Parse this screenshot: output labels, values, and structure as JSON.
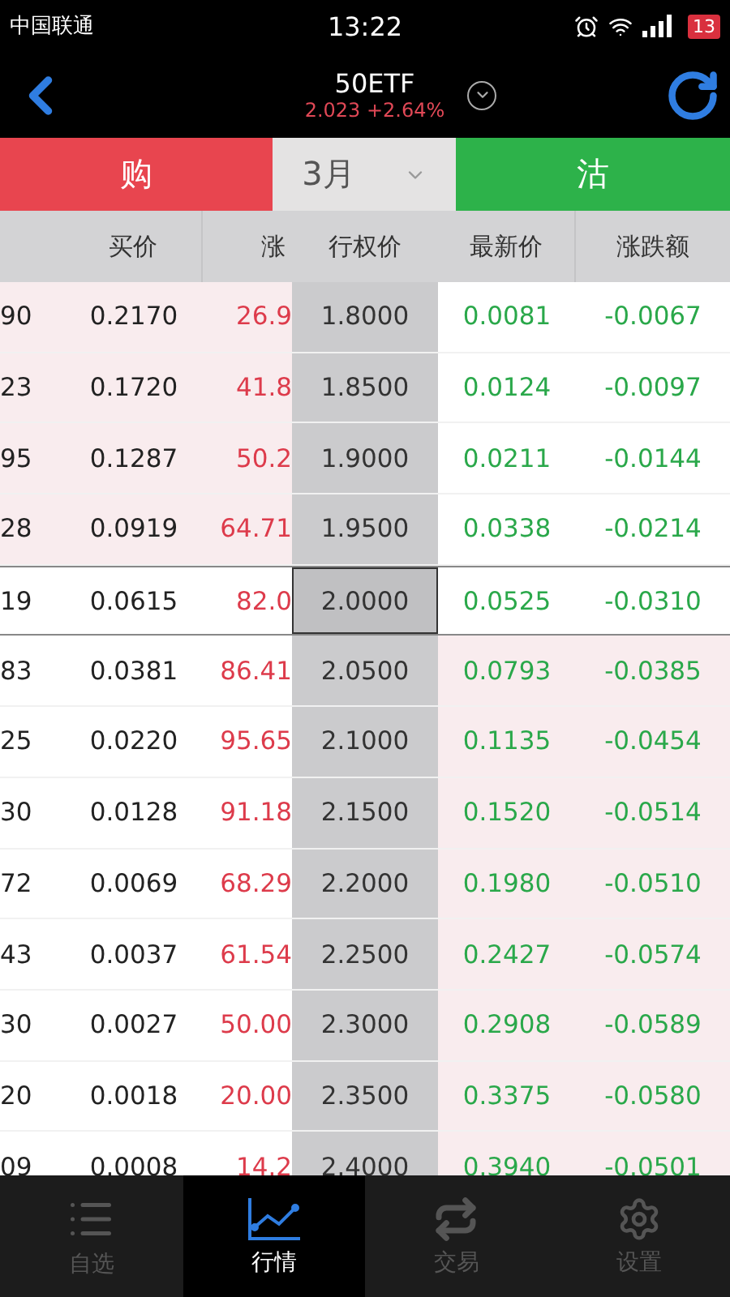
{
  "status_bar": {
    "carrier": "中国联通",
    "time": "13:22",
    "battery": "13"
  },
  "nav": {
    "title": "50ETF",
    "quote": "2.023 +2.64%"
  },
  "segments": [
    {
      "label": "购",
      "kind": "call"
    },
    {
      "label": "3月",
      "kind": "month"
    },
    {
      "label": "沽",
      "kind": "put"
    }
  ],
  "table": {
    "columns": [
      "",
      "买价",
      "涨",
      "行权价",
      "最新价",
      "涨跌额"
    ],
    "rows": [
      {
        "cells": [
          "90",
          "0.2170",
          "26.9",
          "1.8000",
          "0.0081",
          "-0.0067"
        ],
        "call_shaded": true,
        "put_shaded": false,
        "selected": false
      },
      {
        "cells": [
          "23",
          "0.1720",
          "41.8",
          "1.8500",
          "0.0124",
          "-0.0097"
        ],
        "call_shaded": true,
        "put_shaded": false,
        "selected": false
      },
      {
        "cells": [
          "95",
          "0.1287",
          "50.2",
          "1.9000",
          "0.0211",
          "-0.0144"
        ],
        "call_shaded": true,
        "put_shaded": false,
        "selected": false
      },
      {
        "cells": [
          "28",
          "0.0919",
          "64.71",
          "1.9500",
          "0.0338",
          "-0.0214"
        ],
        "call_shaded": true,
        "put_shaded": false,
        "selected": false
      },
      {
        "cells": [
          "19",
          "0.0615",
          "82.0",
          "2.0000",
          "0.0525",
          "-0.0310"
        ],
        "call_shaded": false,
        "put_shaded": false,
        "selected": true
      },
      {
        "cells": [
          "83",
          "0.0381",
          "86.41",
          "2.0500",
          "0.0793",
          "-0.0385"
        ],
        "call_shaded": false,
        "put_shaded": true,
        "selected": false
      },
      {
        "cells": [
          "25",
          "0.0220",
          "95.65",
          "2.1000",
          "0.1135",
          "-0.0454"
        ],
        "call_shaded": false,
        "put_shaded": true,
        "selected": false
      },
      {
        "cells": [
          "30",
          "0.0128",
          "91.18",
          "2.1500",
          "0.1520",
          "-0.0514"
        ],
        "call_shaded": false,
        "put_shaded": true,
        "selected": false
      },
      {
        "cells": [
          "72",
          "0.0069",
          "68.29",
          "2.2000",
          "0.1980",
          "-0.0510"
        ],
        "call_shaded": false,
        "put_shaded": true,
        "selected": false
      },
      {
        "cells": [
          "43",
          "0.0037",
          "61.54",
          "2.2500",
          "0.2427",
          "-0.0574"
        ],
        "call_shaded": false,
        "put_shaded": true,
        "selected": false
      },
      {
        "cells": [
          "30",
          "0.0027",
          "50.00",
          "2.3000",
          "0.2908",
          "-0.0589"
        ],
        "call_shaded": false,
        "put_shaded": true,
        "selected": false
      },
      {
        "cells": [
          "20",
          "0.0018",
          "20.00",
          "2.3500",
          "0.3375",
          "-0.0580"
        ],
        "call_shaded": false,
        "put_shaded": true,
        "selected": false
      },
      {
        "cells": [
          "09",
          "0.0008",
          "14.2",
          "2.4000",
          "0.3940",
          "-0.0501"
        ],
        "call_shaded": false,
        "put_shaded": true,
        "selected": false
      }
    ]
  },
  "tab_bar": [
    {
      "label": "自选",
      "kind": "list",
      "selected": false
    },
    {
      "label": "行情",
      "kind": "chart",
      "selected": true
    },
    {
      "label": "交易",
      "kind": "trade",
      "selected": false
    },
    {
      "label": "设置",
      "kind": "settings",
      "selected": false
    }
  ]
}
